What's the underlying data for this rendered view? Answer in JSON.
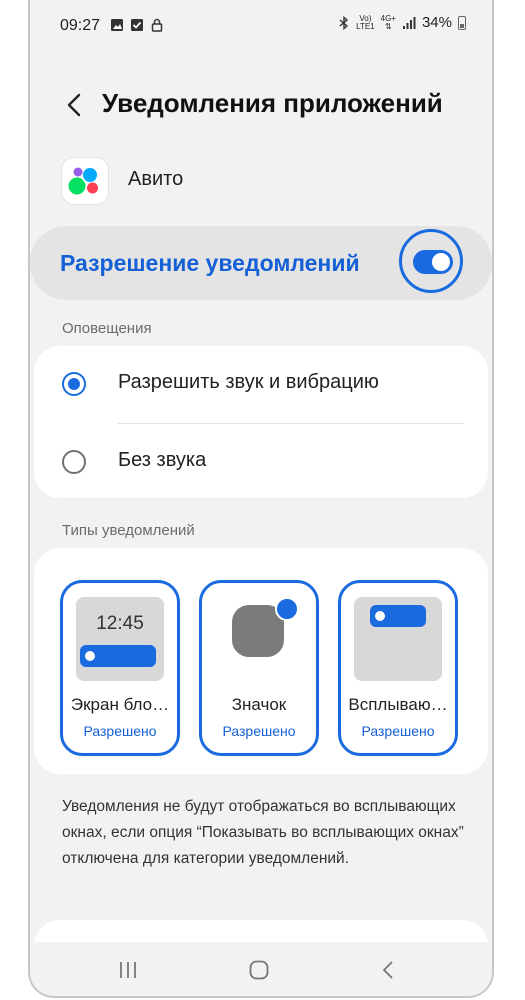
{
  "status_bar": {
    "time": "09:27",
    "network_top": "Vo)",
    "network_bottom": "LTE1",
    "net_type": "4G+",
    "battery": "34%"
  },
  "header": {
    "title": "Уведомления приложений"
  },
  "app": {
    "name": "Авито"
  },
  "permission": {
    "label": "Разрешение уведомлений",
    "enabled": true
  },
  "alerts": {
    "section_label": "Оповещения",
    "options": [
      {
        "label": "Разрешить звук и вибрацию",
        "selected": true
      },
      {
        "label": "Без звука",
        "selected": false
      }
    ]
  },
  "notification_types": {
    "section_label": "Типы уведомлений",
    "items": [
      {
        "name": "Экран бло…",
        "status": "Разрешено",
        "preview_time": "12:45"
      },
      {
        "name": "Значок",
        "status": "Разрешено"
      },
      {
        "name": "Всплываю…",
        "status": "Разрешено"
      }
    ]
  },
  "note": "Уведомления не будут отображаться во всплывающих окнах, если опция “Показывать во всплывающих окнах” отключена для категории уведомлений.",
  "colors": {
    "accent": "#1a6ae0",
    "accent_text": "#1560d6",
    "background": "#f2f2f2"
  }
}
